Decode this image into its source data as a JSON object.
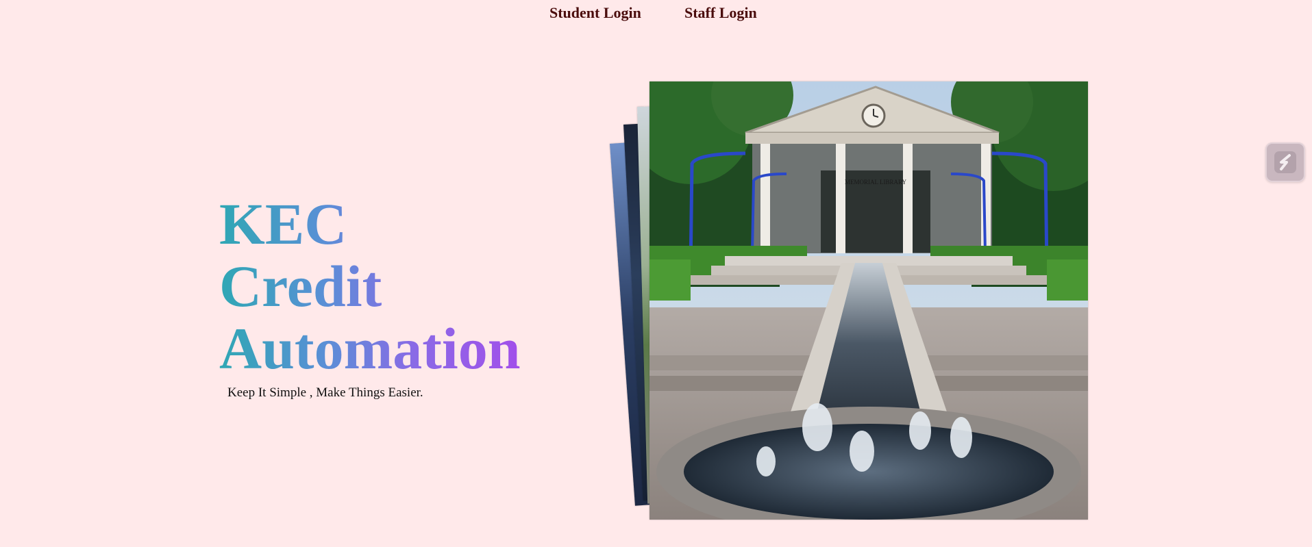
{
  "nav": {
    "student_login": "Student Login",
    "staff_login": "Staff Login"
  },
  "hero": {
    "title_line1": "KEC",
    "title_line2": "Credit",
    "title_line3": "Automation",
    "tagline": "Keep It Simple , Make Things Easier."
  },
  "photo": {
    "signboard": "MEMORIAL LIBRARY"
  },
  "colors": {
    "background": "#ffe9ea",
    "nav_link": "#4a0c0c",
    "gradient_start": "#2fa7b4",
    "gradient_end": "#a24fea"
  },
  "icons": {
    "widget": "slash-widget-icon"
  }
}
